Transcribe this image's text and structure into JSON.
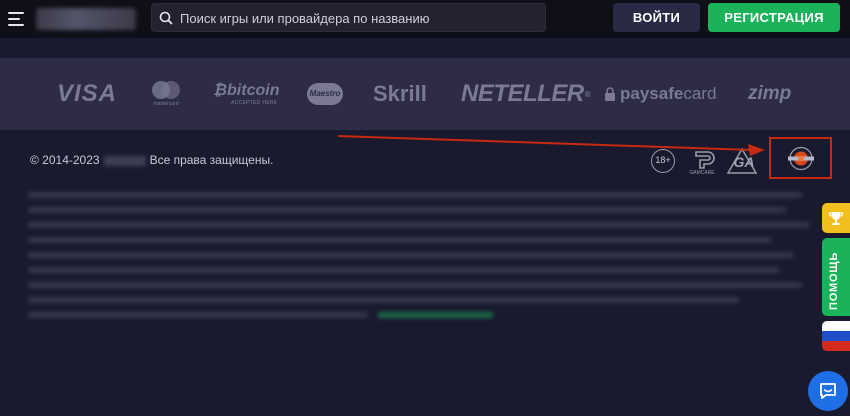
{
  "header": {
    "search_placeholder": "Поиск игры или провайдера по названию",
    "login_label": "ВОЙТИ",
    "register_label": "РЕГИСТРАЦИЯ"
  },
  "payments": [
    {
      "name": "visa",
      "label": "VISA"
    },
    {
      "name": "mastercard",
      "label": "mastercard"
    },
    {
      "name": "bitcoin",
      "label": "bitcoin",
      "sub": "ACCEPTED HERE"
    },
    {
      "name": "maestro",
      "label": "Maestro"
    },
    {
      "name": "skrill",
      "label": "Skrill"
    },
    {
      "name": "neteller",
      "label": "NETELLER"
    },
    {
      "name": "paysafecard",
      "label_bold": "paysafe",
      "label_thin": "card"
    },
    {
      "name": "zimpler",
      "label": "zimp"
    }
  ],
  "footer": {
    "copyright_years": "© 2014-2023",
    "copyright_rights": "Все права защищены.",
    "age_badge": "18+",
    "gamcare_label": "GAMCARE"
  },
  "side": {
    "help_label": "ПОМОЩЬ"
  },
  "colors": {
    "background": "#1a1a2e",
    "payments_band": "#2d2b45",
    "register_green": "#1bb35a",
    "login_dark": "#2a2a44",
    "highlight_red": "#c62a10",
    "trophy_yellow": "#f2c01e",
    "chat_blue": "#1e6fe6"
  },
  "icons": {
    "menu": "hamburger-icon",
    "search": "search-icon",
    "trophy": "trophy-icon",
    "chat": "chat-icon",
    "flag": "russia-flag-icon"
  }
}
